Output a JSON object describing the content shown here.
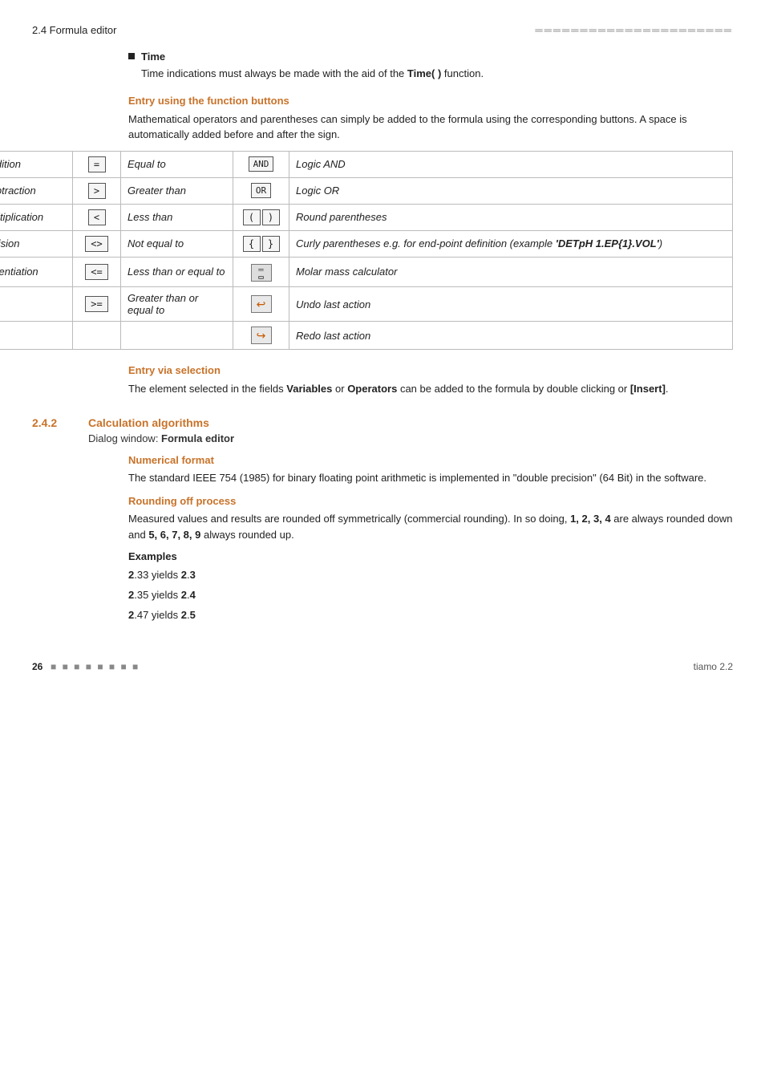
{
  "header": {
    "left": "2.4 Formula editor",
    "right": "═══════════════════════"
  },
  "time_section": {
    "heading": "Time",
    "body": "Time indications must always be made with the aid of the Time( ) function."
  },
  "entry_function_buttons": {
    "heading": "Entry using the function buttons",
    "body": "Mathematical operators and parentheses can simply be added to the formula using the corresponding buttons. A space is automatically added before and after the sign."
  },
  "table": {
    "rows": [
      {
        "btn1": "+",
        "label1": "Addition",
        "btn2": "=",
        "label2": "Equal to",
        "btn3": "AND",
        "label3": "Logic AND"
      },
      {
        "btn1": "−",
        "label1": "Subtraction",
        "btn2": ">",
        "label2": "Greater than",
        "btn3": "OR",
        "label3": "Logic OR"
      },
      {
        "btn1": "×",
        "label1": "Multiplication",
        "btn2": "<",
        "label2": "Less than",
        "btn3": "( )",
        "label3": "Round parentheses"
      },
      {
        "btn1": "ƒ",
        "label1": "Division",
        "btn2": "<>",
        "label2": "Not equal to",
        "btn3": "{ }",
        "label3": "Curly parentheses e.g. for end-point definition (example 'DETpH 1.EP{1}.VOL')"
      },
      {
        "btn1": "∧",
        "label1": "Potentiation",
        "btn2": "<=",
        "label2": "Less than or equal to",
        "btn3": "molar",
        "label3": "Molar mass calculator"
      },
      {
        "btn1": "",
        "label1": "",
        "btn2": ">=",
        "label2": "Greater than or equal to",
        "btn3": "undo",
        "label3": "Undo last action"
      },
      {
        "btn1": "",
        "label1": "",
        "btn2": "",
        "label2": "",
        "btn3": "redo",
        "label3": "Redo last action"
      }
    ]
  },
  "entry_selection": {
    "heading": "Entry via selection",
    "body_start": "The element selected in the fields ",
    "bold1": "Variables",
    "body_mid": " or ",
    "bold2": "Operators",
    "body_end": " can be added to the formula by double clicking or ",
    "bold3": "[Insert]",
    "body_final": "."
  },
  "section_242": {
    "number": "2.4.2",
    "title": "Calculation algorithms",
    "dialog_ref": "Dialog window: Formula editor",
    "numerical_format": {
      "heading": "Numerical format",
      "body": "The standard IEEE 754 (1985) for binary floating point arithmetic is implemented in \"double precision\" (64 Bit) in the software."
    },
    "rounding": {
      "heading": "Rounding off process",
      "body_start": "Measured values and results are rounded off symmetrically (commercial rounding). In so doing, ",
      "bold1": "1, 2, 3, 4",
      "body_mid": " are always rounded down and ",
      "bold2": "5, 6, 7, 8, 9",
      "body_end": " always rounded up.",
      "examples_heading": "Examples",
      "examples": [
        {
          "val": "2.33",
          "yields": "yields",
          "result": "2.3"
        },
        {
          "val": "2.35",
          "yields": "yields",
          "result": "2.4"
        },
        {
          "val": "2.47",
          "yields": "yields",
          "result": "2.5"
        }
      ]
    }
  },
  "footer": {
    "page_number": "26",
    "dots": "■ ■ ■ ■ ■ ■ ■ ■",
    "product": "tiamo 2.2"
  }
}
